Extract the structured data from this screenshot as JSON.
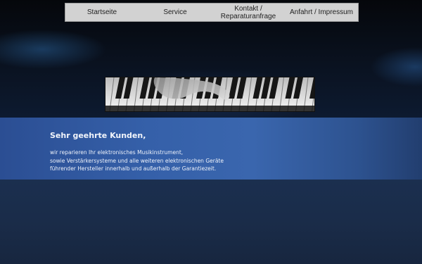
{
  "nav": {
    "items": [
      {
        "label": "Startseite"
      },
      {
        "label": "Service"
      },
      {
        "label": "Kontakt /\nReparaturanfrage"
      },
      {
        "label": "Anfahrt / Impressum"
      }
    ]
  },
  "intro": {
    "title": "Sehr geehrte Kunden,",
    "lines": [
      "wir reparieren Ihr elektronisches Musikinstrument,",
      "sowie Verstärkersysteme und alle weiteren elektronischen Geräte",
      "führender Hersteller innerhalb und außerhalb der Garantiezeit."
    ]
  },
  "colors": {
    "band": "#3560a9",
    "nav_bg": "#d2d2d2",
    "page_bg": "#06080d",
    "lower_bg": "#1b2f4f"
  }
}
